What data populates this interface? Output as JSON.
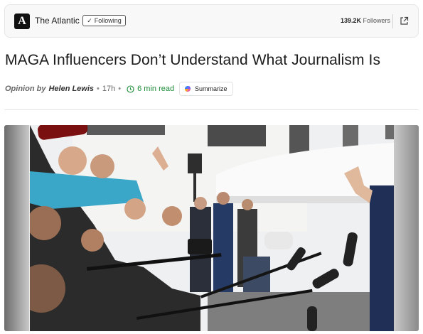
{
  "source": {
    "logo_letter": "A",
    "name": "The Atlantic",
    "follow_label": "Following",
    "follow_check": "✓",
    "followers_count": "139.2K",
    "followers_label": "Followers"
  },
  "article": {
    "headline": "MAGA Influencers Don’t Understand What Journalism Is",
    "opinion_label": "Opinion by",
    "author": "Helen Lewis",
    "age": "17h",
    "read_time": "6 min read",
    "summarize_label": "Summarize"
  },
  "icons": {
    "share": "external-link-icon",
    "clock": "clock-icon",
    "summarize": "copilot-icon"
  },
  "colors": {
    "accent_green": "#1e8d3a",
    "text_primary": "#1b1b1b"
  },
  "hero_image": {
    "subject": "photo"
  }
}
